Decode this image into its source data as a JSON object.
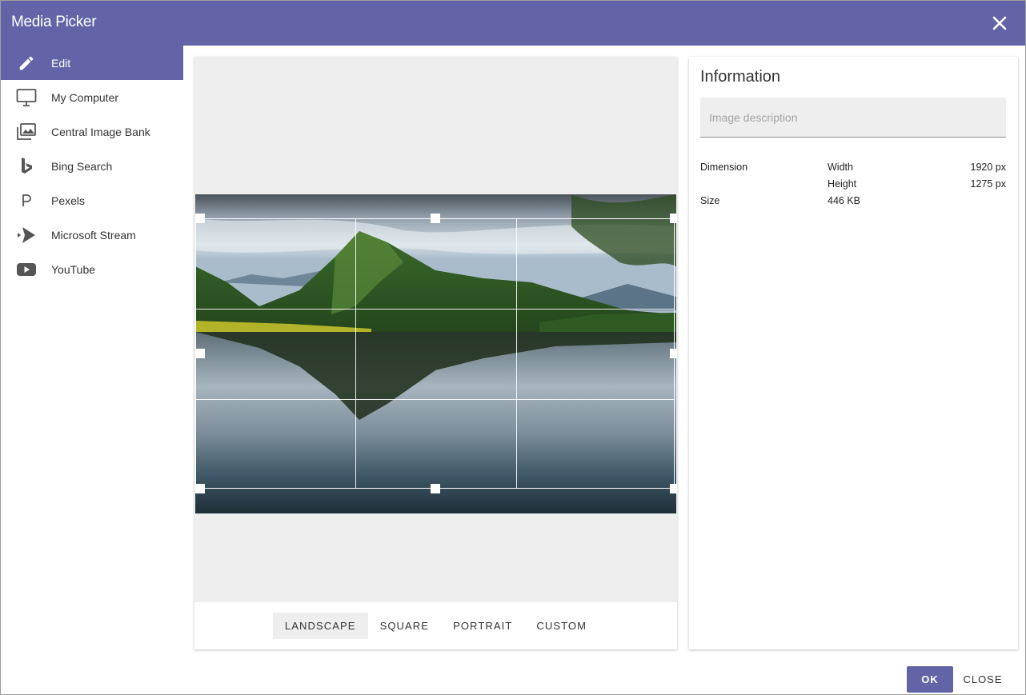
{
  "window": {
    "title": "Media Picker",
    "close_icon": "close-icon"
  },
  "sidebar": {
    "items": [
      {
        "label": "Edit",
        "icon": "pencil-icon",
        "active": true
      },
      {
        "label": "My Computer",
        "icon": "monitor-icon"
      },
      {
        "label": "Central Image Bank",
        "icon": "image-gallery-icon"
      },
      {
        "label": "Bing Search",
        "icon": "bing-icon"
      },
      {
        "label": "Pexels",
        "icon": "pexels-icon"
      },
      {
        "label": "Microsoft Stream",
        "icon": "stream-icon"
      },
      {
        "label": "YouTube",
        "icon": "youtube-icon"
      }
    ]
  },
  "editor": {
    "image_description": "mountain lake landscape",
    "ratios": [
      "LANDSCAPE",
      "SQUARE",
      "PORTRAIT",
      "CUSTOM"
    ],
    "selected_ratio": "LANDSCAPE"
  },
  "info": {
    "heading": "Information",
    "description_placeholder": "Image description",
    "dimension_label": "Dimension",
    "width_label": "Width",
    "width_value": "1920 px",
    "height_label": "Height",
    "height_value": "1275 px",
    "size_label": "Size",
    "size_value": "446 KB"
  },
  "footer": {
    "ok_label": "OK",
    "close_label": "CLOSE"
  },
  "colors": {
    "accent": "#6264a7",
    "panel_bg": "#eeeeee"
  }
}
